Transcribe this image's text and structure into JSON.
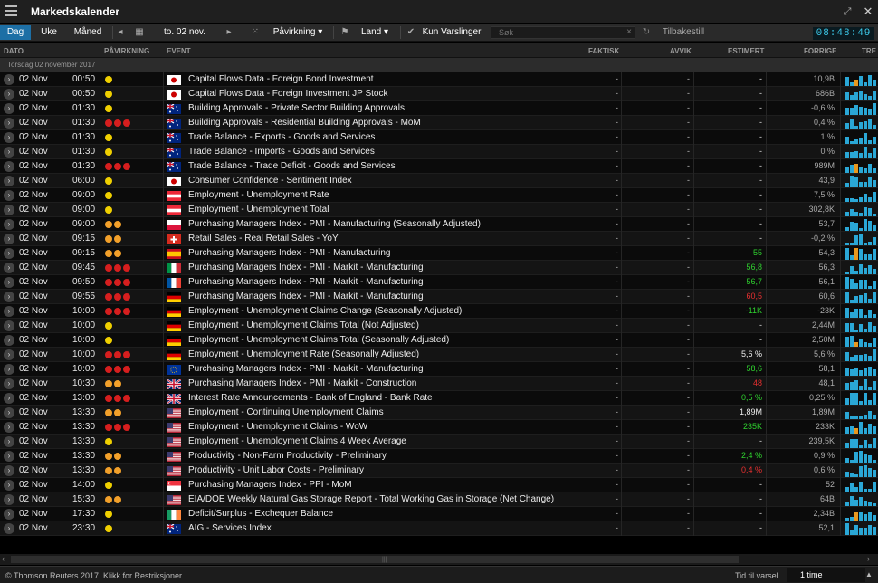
{
  "window": {
    "title": "Markedskalender"
  },
  "toolbar": {
    "day": "Dag",
    "week": "Uke",
    "month": "Måned",
    "date_label": "to. 02 nov.",
    "impact": "Påvirkning ▾",
    "country": "Land ▾",
    "alerts": "Kun Varslinger",
    "search_placeholder": "Søk",
    "reset": "Tilbakestill",
    "clock": "08:48:49"
  },
  "columns": {
    "date": "DATO",
    "impact": "PÅVIRKNING",
    "event": "EVENT",
    "actual": "FAKTISK",
    "deviation": "AVVIK",
    "estimate": "ESTIMERT",
    "previous": "FORRIGE",
    "trend": "TRE"
  },
  "group": "Torsdag 02 november 2017",
  "rows": [
    {
      "date": "02 Nov",
      "time": "00:50",
      "impact": "y",
      "flag": "jp",
      "event": "Capital Flows Data - Foreign Bond Investment",
      "actual": "-",
      "deviation": "-",
      "estimate": "-",
      "est_color": "",
      "previous": "10,9B"
    },
    {
      "date": "02 Nov",
      "time": "00:50",
      "impact": "y",
      "flag": "jp",
      "event": "Capital Flows Data - Foreign Investment JP Stock",
      "actual": "-",
      "deviation": "-",
      "estimate": "-",
      "est_color": "",
      "previous": "686B"
    },
    {
      "date": "02 Nov",
      "time": "01:30",
      "impact": "y",
      "flag": "au",
      "event": "Building Approvals - Private Sector Building Approvals",
      "actual": "-",
      "deviation": "-",
      "estimate": "-",
      "est_color": "",
      "previous": "-0,6 %"
    },
    {
      "date": "02 Nov",
      "time": "01:30",
      "impact": "rrr",
      "flag": "au",
      "event": "Building Approvals - Residential Building Approvals - MoM",
      "actual": "-",
      "deviation": "-",
      "estimate": "-",
      "est_color": "",
      "previous": "0,4 %"
    },
    {
      "date": "02 Nov",
      "time": "01:30",
      "impact": "y",
      "flag": "au",
      "event": "Trade Balance - Exports - Goods and Services",
      "actual": "-",
      "deviation": "-",
      "estimate": "-",
      "est_color": "",
      "previous": "1 %"
    },
    {
      "date": "02 Nov",
      "time": "01:30",
      "impact": "y",
      "flag": "au",
      "event": "Trade Balance - Imports - Goods and Services",
      "actual": "-",
      "deviation": "-",
      "estimate": "-",
      "est_color": "",
      "previous": "0 %"
    },
    {
      "date": "02 Nov",
      "time": "01:30",
      "impact": "rrr",
      "flag": "au",
      "event": "Trade Balance - Trade Deficit - Goods and Services",
      "actual": "-",
      "deviation": "-",
      "estimate": "-",
      "est_color": "",
      "previous": "989M"
    },
    {
      "date": "02 Nov",
      "time": "06:00",
      "impact": "y",
      "flag": "jp",
      "event": "Consumer Confidence - Sentiment Index",
      "actual": "-",
      "deviation": "-",
      "estimate": "-",
      "est_color": "",
      "previous": "43,9"
    },
    {
      "date": "02 Nov",
      "time": "09:00",
      "impact": "y",
      "flag": "at",
      "event": "Employment - Unemployment Rate",
      "actual": "-",
      "deviation": "-",
      "estimate": "-",
      "est_color": "",
      "previous": "7,5 %"
    },
    {
      "date": "02 Nov",
      "time": "09:00",
      "impact": "y",
      "flag": "at",
      "event": "Employment - Unemployment Total",
      "actual": "-",
      "deviation": "-",
      "estimate": "-",
      "est_color": "",
      "previous": "302,8K"
    },
    {
      "date": "02 Nov",
      "time": "09:00",
      "impact": "oo",
      "flag": "pl",
      "event": "Purchasing Managers Index - PMI - Manufacturing (Seasonally Adjusted)",
      "actual": "-",
      "deviation": "-",
      "estimate": "-",
      "est_color": "",
      "previous": "53,7"
    },
    {
      "date": "02 Nov",
      "time": "09:15",
      "impact": "oo",
      "flag": "ch",
      "event": "Retail Sales - Real Retail Sales - YoY",
      "actual": "-",
      "deviation": "-",
      "estimate": "-",
      "est_color": "",
      "previous": "-0,2 %"
    },
    {
      "date": "02 Nov",
      "time": "09:15",
      "impact": "oo",
      "flag": "es",
      "event": "Purchasing Managers Index - PMI - Manufacturing",
      "actual": "-",
      "deviation": "-",
      "estimate": "55",
      "est_color": "g",
      "previous": "54,3"
    },
    {
      "date": "02 Nov",
      "time": "09:45",
      "impact": "rrr",
      "flag": "it",
      "event": "Purchasing Managers Index - PMI - Markit - Manufacturing",
      "actual": "-",
      "deviation": "-",
      "estimate": "56,8",
      "est_color": "g",
      "previous": "56,3"
    },
    {
      "date": "02 Nov",
      "time": "09:50",
      "impact": "rrr",
      "flag": "fr",
      "event": "Purchasing Managers Index - PMI - Markit - Manufacturing",
      "actual": "-",
      "deviation": "-",
      "estimate": "56,7",
      "est_color": "g",
      "previous": "56,1"
    },
    {
      "date": "02 Nov",
      "time": "09:55",
      "impact": "rrr",
      "flag": "de",
      "event": "Purchasing Managers Index - PMI - Markit - Manufacturing",
      "actual": "-",
      "deviation": "-",
      "estimate": "60,5",
      "est_color": "r",
      "previous": "60,6"
    },
    {
      "date": "02 Nov",
      "time": "10:00",
      "impact": "rrr",
      "flag": "de",
      "event": "Employment - Unemployment Claims Change (Seasonally Adjusted)",
      "actual": "-",
      "deviation": "-",
      "estimate": "-11K",
      "est_color": "g",
      "previous": "-23K"
    },
    {
      "date": "02 Nov",
      "time": "10:00",
      "impact": "y",
      "flag": "de",
      "event": "Employment - Unemployment Claims Total (Not Adjusted)",
      "actual": "-",
      "deviation": "-",
      "estimate": "-",
      "est_color": "",
      "previous": "2,44M"
    },
    {
      "date": "02 Nov",
      "time": "10:00",
      "impact": "y",
      "flag": "de",
      "event": "Employment - Unemployment Claims Total (Seasonally Adjusted)",
      "actual": "-",
      "deviation": "-",
      "estimate": "-",
      "est_color": "",
      "previous": "2,50M"
    },
    {
      "date": "02 Nov",
      "time": "10:00",
      "impact": "rrr",
      "flag": "de",
      "event": "Employment - Unemployment Rate (Seasonally Adjusted)",
      "actual": "-",
      "deviation": "-",
      "estimate": "5,6 %",
      "est_color": "w",
      "previous": "5,6 %"
    },
    {
      "date": "02 Nov",
      "time": "10:00",
      "impact": "rrr",
      "flag": "eu",
      "event": "Purchasing Managers Index - PMI - Markit - Manufacturing",
      "actual": "-",
      "deviation": "-",
      "estimate": "58,6",
      "est_color": "g",
      "previous": "58,1"
    },
    {
      "date": "02 Nov",
      "time": "10:30",
      "impact": "oo",
      "flag": "gb",
      "event": "Purchasing Managers Index - PMI - Markit - Construction",
      "actual": "-",
      "deviation": "-",
      "estimate": "48",
      "est_color": "r",
      "previous": "48,1"
    },
    {
      "date": "02 Nov",
      "time": "13:00",
      "impact": "rrr",
      "flag": "gb",
      "event": "Interest Rate Announcements - Bank of England - Bank Rate",
      "actual": "-",
      "deviation": "-",
      "estimate": "0,5 %",
      "est_color": "g",
      "previous": "0,25 %"
    },
    {
      "date": "02 Nov",
      "time": "13:30",
      "impact": "oo",
      "flag": "us",
      "event": "Employment - Continuing Unemployment Claims",
      "actual": "-",
      "deviation": "-",
      "estimate": "1,89M",
      "est_color": "w",
      "previous": "1,89M"
    },
    {
      "date": "02 Nov",
      "time": "13:30",
      "impact": "rrr",
      "flag": "us",
      "event": "Employment - Unemployment Claims - WoW",
      "actual": "-",
      "deviation": "-",
      "estimate": "235K",
      "est_color": "g",
      "previous": "233K"
    },
    {
      "date": "02 Nov",
      "time": "13:30",
      "impact": "y",
      "flag": "us",
      "event": "Employment - Unemployment Claims 4 Week Average",
      "actual": "-",
      "deviation": "-",
      "estimate": "-",
      "est_color": "",
      "previous": "239,5K"
    },
    {
      "date": "02 Nov",
      "time": "13:30",
      "impact": "oo",
      "flag": "us",
      "event": "Productivity - Non-Farm Productivity - Preliminary",
      "actual": "-",
      "deviation": "-",
      "estimate": "2,4 %",
      "est_color": "g",
      "previous": "0,9 %"
    },
    {
      "date": "02 Nov",
      "time": "13:30",
      "impact": "oo",
      "flag": "us",
      "event": "Productivity - Unit Labor Costs - Preliminary",
      "actual": "-",
      "deviation": "-",
      "estimate": "0,4 %",
      "est_color": "r",
      "previous": "0,6 %"
    },
    {
      "date": "02 Nov",
      "time": "14:00",
      "impact": "y",
      "flag": "sg",
      "event": "Purchasing Managers Index - PPI - MoM",
      "actual": "-",
      "deviation": "-",
      "estimate": "-",
      "est_color": "",
      "previous": "52"
    },
    {
      "date": "02 Nov",
      "time": "15:30",
      "impact": "oo",
      "flag": "us",
      "event": "EIA/DOE Weekly Natural Gas Storage Report - Total Working Gas in Storage (Net Change)",
      "actual": "-",
      "deviation": "-",
      "estimate": "-",
      "est_color": "",
      "previous": "64B"
    },
    {
      "date": "02 Nov",
      "time": "17:30",
      "impact": "y",
      "flag": "ie",
      "event": "Deficit/Surplus - Exchequer Balance",
      "actual": "-",
      "deviation": "-",
      "estimate": "-",
      "est_color": "",
      "previous": "2,34B"
    },
    {
      "date": "02 Nov",
      "time": "23:30",
      "impact": "y",
      "flag": "au",
      "event": "AIG - Services Index",
      "actual": "-",
      "deviation": "-",
      "estimate": "-",
      "est_color": "",
      "previous": "52,1"
    }
  ],
  "status": {
    "copyright": "© Thomson Reuters 2017. Klikk for Restriksjoner.",
    "time_to_release": "Tid til varsel",
    "hour": "1 time"
  }
}
